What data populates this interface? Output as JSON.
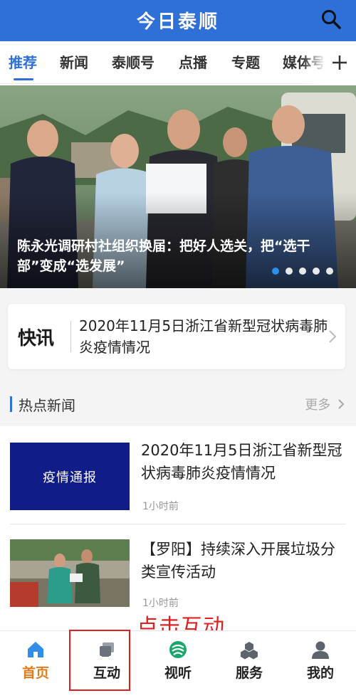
{
  "header": {
    "title": "今日泰顺"
  },
  "tabs": [
    {
      "label": "推荐"
    },
    {
      "label": "新闻"
    },
    {
      "label": "泰顺号"
    },
    {
      "label": "点播"
    },
    {
      "label": "专题"
    },
    {
      "label": "媒体号"
    }
  ],
  "banner": {
    "caption": "陈永光调研村社组织换届：把好人选关，把“选干部”变成“选发展”",
    "slide_count": 5,
    "active_slide": 1
  },
  "kuaixun": {
    "logo": "快讯",
    "text": "2020年11月5日浙江省新型冠状病毒肺炎疫情情况"
  },
  "section": {
    "title": "热点新闻",
    "more": "更多"
  },
  "news": [
    {
      "thumb_text": "疫情通报",
      "title": "2020年11月5日浙江省新型冠状病毒肺炎疫情情况",
      "time": "1小时前"
    },
    {
      "title": "【罗阳】持续深入开展垃圾分类宣传活动",
      "time": "1小时前"
    }
  ],
  "annotation": "点击互动",
  "bottom_nav": [
    {
      "label": "首页",
      "icon": "home-icon",
      "active": true
    },
    {
      "label": "互动",
      "icon": "interact-icon",
      "active": false
    },
    {
      "label": "视听",
      "icon": "media-icon",
      "active": false
    },
    {
      "label": "服务",
      "icon": "service-icon",
      "active": false
    },
    {
      "label": "我的",
      "icon": "profile-icon",
      "active": false
    }
  ],
  "colors": {
    "brand": "#2f6fd8",
    "active_nav": "#e07c1c",
    "annotation": "#e02020"
  }
}
